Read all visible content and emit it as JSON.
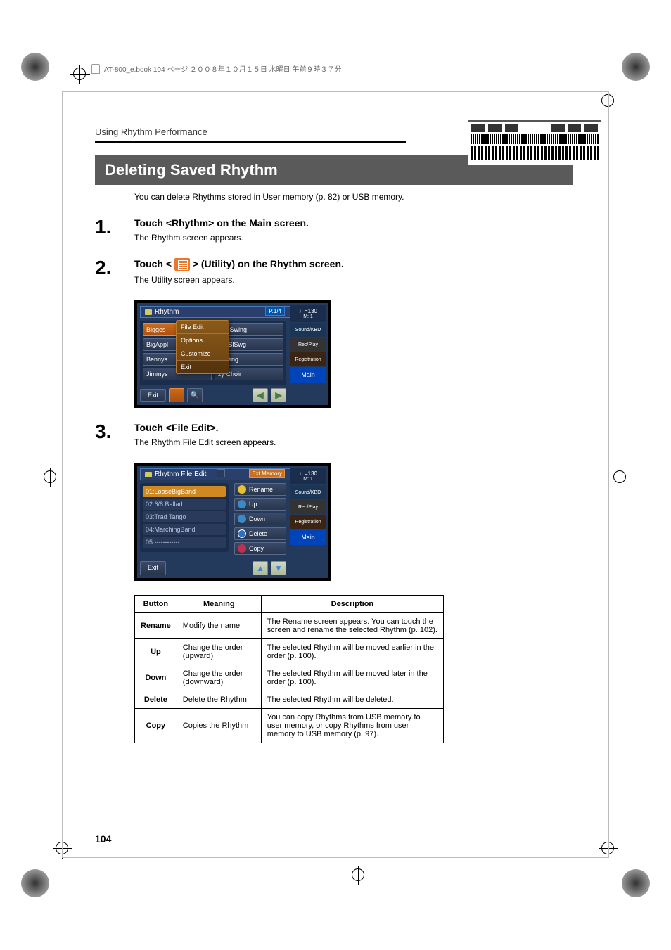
{
  "header_note": "AT-800_e.book 104 ページ ２００８年１０月１５日 水曜日 午前９時３７分",
  "breadcrumb": "Using Rhythm Performance",
  "section_title": "Deleting Saved Rhythm",
  "intro": "You can delete Rhythms stored in User memory (p. 82) or USB memory.",
  "steps": [
    {
      "num": "1.",
      "title": "Touch <Rhythm> on the Main screen.",
      "sub": "The Rhythm screen appears."
    },
    {
      "num": "2.",
      "title_pre": "Touch < ",
      "title_post": " > (Utility) on the Rhythm screen.",
      "sub": "The Utility screen appears."
    },
    {
      "num": "3.",
      "title": "Touch <File Edit>.",
      "sub": "The Rhythm File Edit screen appears."
    }
  ],
  "screenshot1": {
    "title": "Rhythm",
    "badge": "P.1/4",
    "tempo": "♩=130",
    "measure": "M:    1",
    "side": {
      "sound": "Sound/KBD",
      "rec": "Rec/Play",
      "reg": "Registration",
      "main": "Main"
    },
    "left_col": [
      "Bigges",
      "BigAppl",
      "Bennys",
      "Jimmys"
    ],
    "right_col": [
      "ezy Swing",
      "hiteSlSwg",
      "l Swing",
      "zy Choir"
    ],
    "menu": [
      "File Edit",
      "Options",
      "Customize",
      "Exit"
    ],
    "exit": "Exit"
  },
  "screenshot2": {
    "title": "Rhythm File Edit",
    "tab": "Ext Memory",
    "tempo": "♩=130",
    "measure": "M:    1",
    "side": {
      "sound": "Sound/KBD",
      "rec": "Rec/Play",
      "reg": "Registration",
      "main": "Main"
    },
    "items": [
      "01:LooseBigBand",
      "02:6/8 Ballad",
      "03:Trad Tango",
      "04:MarchingBand",
      "05:------------"
    ],
    "actions": [
      "Rename",
      "Up",
      "Down",
      "Delete",
      "Copy"
    ],
    "exit": "Exit"
  },
  "table": {
    "headers": [
      "Button",
      "Meaning",
      "Description"
    ],
    "rows": [
      {
        "b": "Rename",
        "m": "Modify the name",
        "d": "The Rename screen appears. You can touch the screen and rename the selected Rhythm (p. 102)."
      },
      {
        "b": "Up",
        "m": "Change the order (upward)",
        "d": "The selected Rhythm will be moved earlier in the order (p. 100)."
      },
      {
        "b": "Down",
        "m": "Change the order (downward)",
        "d": "The selected Rhythm will be moved later in the order (p. 100)."
      },
      {
        "b": "Delete",
        "m": "Delete the Rhythm",
        "d": "The selected Rhythm will be deleted."
      },
      {
        "b": "Copy",
        "m": "Copies the Rhythm",
        "d": "You can copy Rhythms from USB memory to user memory, or copy Rhythms from user memory to USB memory (p. 97)."
      }
    ]
  },
  "page_number": "104"
}
